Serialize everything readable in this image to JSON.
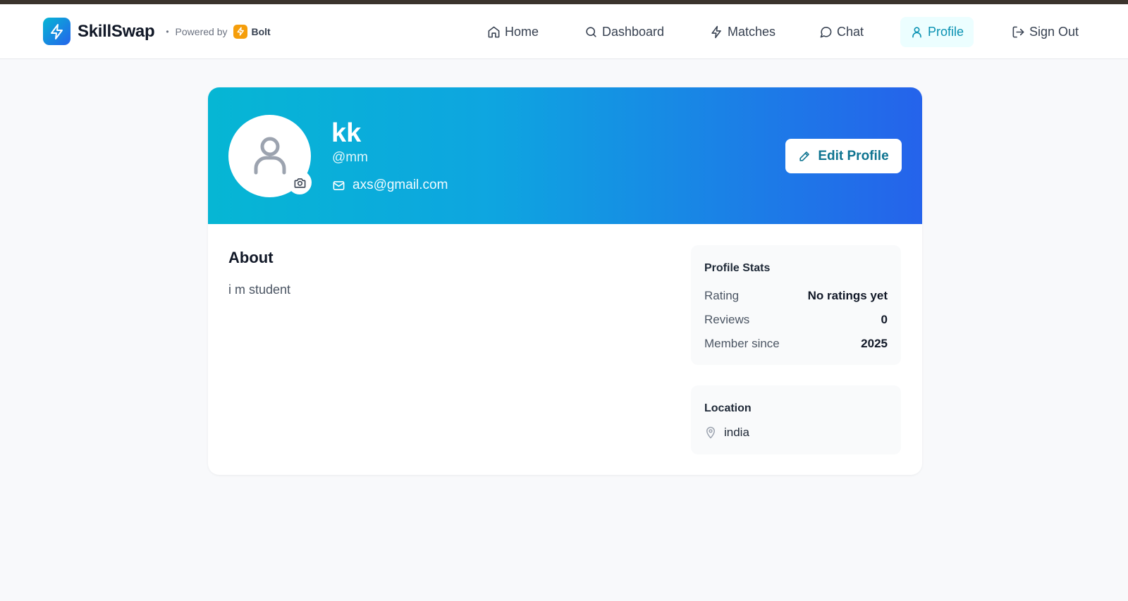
{
  "brand": {
    "name": "SkillSwap",
    "separator": "•",
    "powered_by": "Powered by",
    "bolt_label": "Bolt"
  },
  "nav": [
    {
      "label": "Home",
      "icon": "home-icon",
      "active": false
    },
    {
      "label": "Dashboard",
      "icon": "search-icon",
      "active": false
    },
    {
      "label": "Matches",
      "icon": "zap-icon",
      "active": false
    },
    {
      "label": "Chat",
      "icon": "chat-bubble-icon",
      "active": false
    },
    {
      "label": "Profile",
      "icon": "user-icon",
      "active": true
    },
    {
      "label": "Sign Out",
      "icon": "logout-icon",
      "active": false
    }
  ],
  "profile": {
    "name": "kk",
    "username": "@mm",
    "email": "axs@gmail.com",
    "edit_label": "Edit Profile"
  },
  "about": {
    "title": "About",
    "text": "i m student"
  },
  "stats": {
    "title": "Profile Stats",
    "rows": [
      {
        "label": "Rating",
        "value": "No ratings yet"
      },
      {
        "label": "Reviews",
        "value": "0"
      },
      {
        "label": "Member since",
        "value": "2025"
      }
    ]
  },
  "location": {
    "title": "Location",
    "value": "india"
  },
  "colors": {
    "accent": "#0891b2",
    "banner_start": "#06b6d4",
    "banner_end": "#2563eb",
    "bolt": "#f59e0b"
  }
}
